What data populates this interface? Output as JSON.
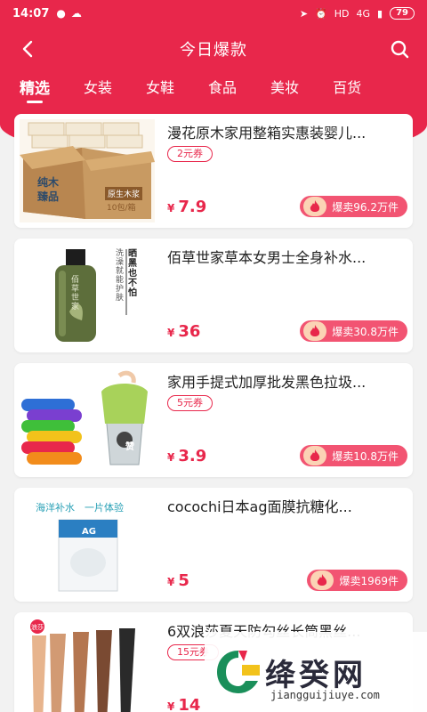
{
  "status_bar": {
    "time": "14:07",
    "network": "4G",
    "battery": "79"
  },
  "header": {
    "title": "今日爆款"
  },
  "tabs": [
    "精选",
    "女装",
    "女鞋",
    "食品",
    "美妆",
    "百货"
  ],
  "active_tab_index": 0,
  "products": [
    {
      "name": "漫花原木家用整箱实惠装婴儿...",
      "coupon": "2元券",
      "price": "7.9",
      "currency": "¥",
      "hot": "爆卖96.2万件"
    },
    {
      "name": "佰草世家草本女男士全身补水...",
      "coupon": "",
      "price": "36",
      "currency": "¥",
      "hot": "爆卖30.8万件"
    },
    {
      "name": "家用手提式加厚批发黑色拉圾...",
      "coupon": "5元券",
      "price": "3.9",
      "currency": "¥",
      "hot": "爆卖10.8万件"
    },
    {
      "name": "cocochi日本ag面膜抗糖化...",
      "coupon": "",
      "price": "5",
      "currency": "¥",
      "hot": "爆卖1969件"
    },
    {
      "name": "6双浪莎夏天防勾丝长筒黑丝...",
      "coupon": "15元券",
      "price": "14",
      "currency": "¥",
      "hot": ""
    }
  ],
  "product_images": {
    "p1_box_line1": "纯木",
    "p1_box_line2": "臻品",
    "p1_box_tag1": "原生木浆",
    "p1_box_tag2": "10包/箱",
    "p2_bottle_text": "佰草世家",
    "p2_side_text1": "晒黑也不怕",
    "p2_side_text2": "洗澡就能护肤",
    "p3_bin_text": "赞",
    "p4_top_text": "海洋补水　一片体验",
    "p4_pack_text": "AG",
    "p5_brand": "浪莎"
  },
  "watermark": {
    "text": "绛癸网",
    "url": "jiangguijiuye.com"
  },
  "colors": {
    "brand_red": "#e8274b",
    "hot_pill": "#f25472"
  }
}
